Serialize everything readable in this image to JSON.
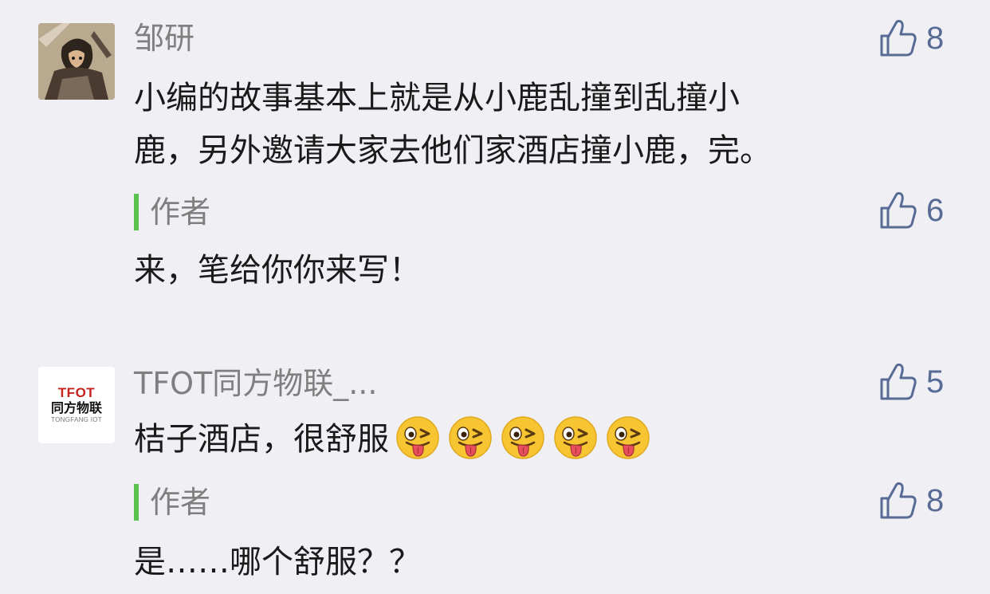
{
  "comments": [
    {
      "avatar": "manga-warrior-avatar",
      "username": "邹研",
      "likes": "8",
      "text_lines": [
        "小编的故事基本上就是从小鹿乱撞到乱撞小",
        "鹿，另外邀请大家去他们家酒店撞小鹿，完。"
      ],
      "reply": {
        "label": "作者",
        "likes": "6",
        "text": "来，笔给你你来写！"
      }
    },
    {
      "avatar": "tfot-logo-avatar",
      "avatar_logo": {
        "line1": "TFOT",
        "line2": "同方物联",
        "line3": "TONGFANG IOT"
      },
      "username": "TFOT同方物联_...",
      "likes": "5",
      "text": "桔子酒店，很舒服",
      "emojis": [
        "winking-tongue-emoji",
        "winking-tongue-emoji",
        "winking-tongue-emoji",
        "winking-tongue-emoji",
        "winking-tongue-emoji"
      ],
      "reply": {
        "label": "作者",
        "likes": "8",
        "text": "是……哪个舒服？？"
      }
    }
  ],
  "colors": {
    "background": "#efeff4",
    "like_blue": "#576b95",
    "author_green": "#5cc24f",
    "name_gray": "#7f7f7f",
    "text": "#1a1a1a",
    "logo_red": "#c8221d"
  }
}
